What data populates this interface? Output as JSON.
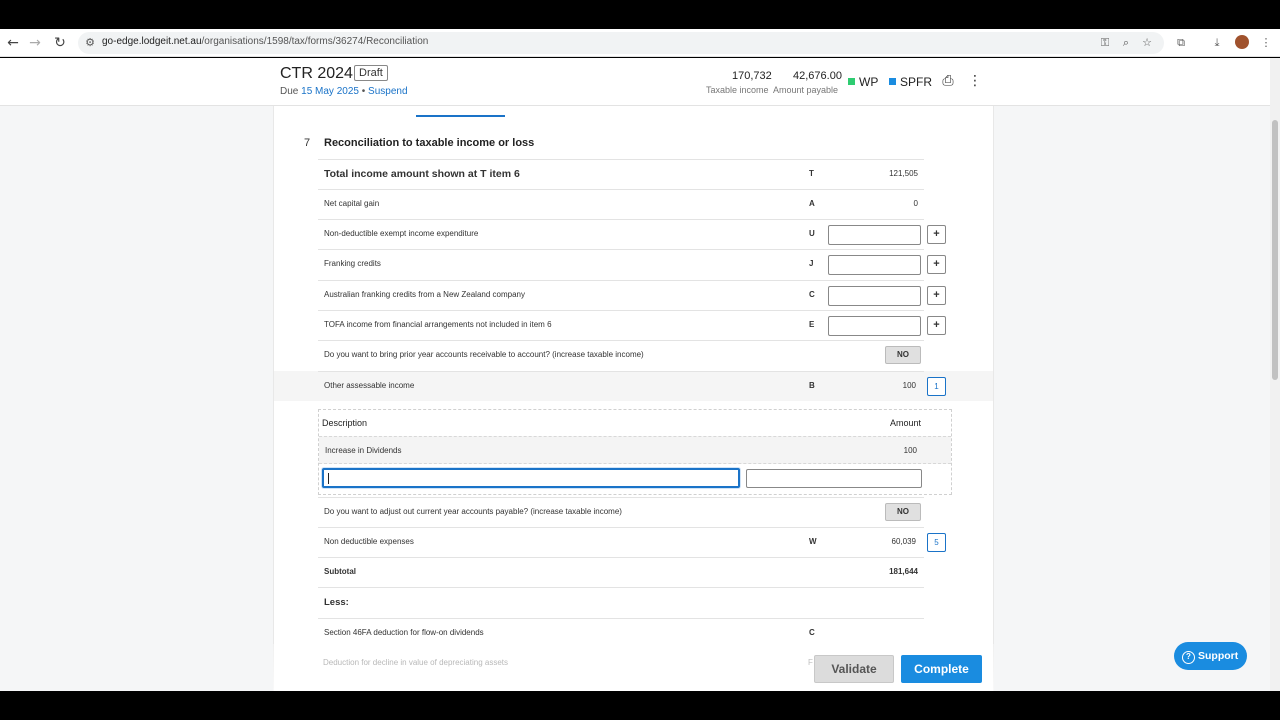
{
  "browser": {
    "url_host": "go-edge.lodgeit.net.au",
    "url_path": "/organisations/1598/tax/forms/36274/Reconciliation",
    "icons": [
      "back-icon",
      "forward-icon",
      "reload-icon",
      "site-info-icon",
      "key-icon",
      "zoom-icon",
      "star-icon",
      "extensions-icon",
      "download-icon",
      "menu-icon"
    ]
  },
  "header": {
    "title": "CTR 2024",
    "status": "Draft",
    "due_prefix": "Due",
    "due_date": "15 May 2025",
    "separator": "•",
    "suspend": "Suspend",
    "taxable_income_value": "170,732",
    "taxable_income_label": "Taxable income",
    "amount_payable_value": "42,676.00",
    "amount_payable_label": "Amount payable",
    "tag_wp": "WP",
    "tag_spfr": "SPFR",
    "colors": {
      "wp": "#2ecc71",
      "spfr": "#1a8ce0"
    }
  },
  "section": {
    "number": "7",
    "title": "Reconciliation to taxable income or loss"
  },
  "rows": {
    "total_income": {
      "label": "Total income amount shown at T item 6",
      "code": "T",
      "value": "121,505"
    },
    "net_capital_gain": {
      "label": "Net capital gain",
      "code": "A",
      "value": "0"
    },
    "non_deductible_exempt": {
      "label": "Non-deductible exempt income expenditure",
      "code": "U"
    },
    "franking_credits": {
      "label": "Franking credits",
      "code": "J"
    },
    "aus_franking_nz": {
      "label": "Australian franking credits from a New Zealand company",
      "code": "C"
    },
    "tofa_income": {
      "label": "TOFA income from financial arrangements not included in item 6",
      "code": "E"
    },
    "prior_year_receivable": {
      "label": "Do you want to bring prior year accounts receivable to account? (increase taxable income)",
      "answer": "NO"
    },
    "other_assessable": {
      "label": "Other assessable income",
      "code": "B",
      "value": "100",
      "count": "1"
    },
    "adjust_payable": {
      "label": "Do you want to adjust out current year accounts payable? (increase taxable income)",
      "answer": "NO"
    },
    "non_deductible_expenses": {
      "label": "Non deductible expenses",
      "code": "W",
      "value": "60,039",
      "count": "5"
    },
    "subtotal": {
      "label": "Subtotal",
      "value": "181,644"
    },
    "less": {
      "label": "Less:"
    },
    "section_46fa": {
      "label": "Section 46FA deduction for flow-on dividends",
      "code": "C"
    },
    "decline_value": {
      "label": "Deduction for decline in value of depreciating assets",
      "code": "F"
    }
  },
  "subtable": {
    "col_description": "Description",
    "col_amount": "Amount",
    "items": [
      {
        "description": "Increase in Dividends",
        "amount": "100"
      }
    ],
    "new_description": "",
    "new_amount": ""
  },
  "buttons": {
    "plus": "+",
    "validate": "Validate",
    "complete": "Complete",
    "support": "Support"
  }
}
